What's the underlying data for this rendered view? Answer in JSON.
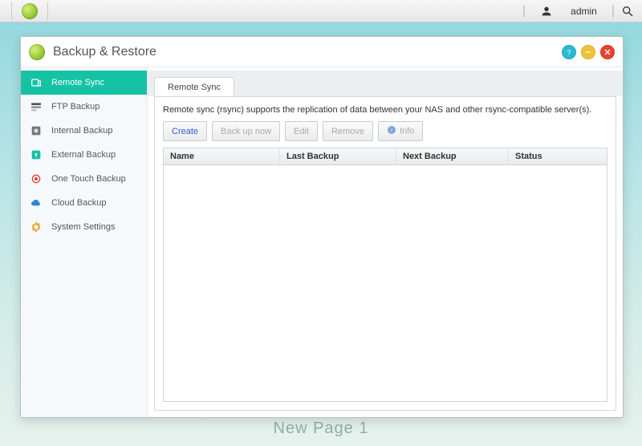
{
  "topbar": {
    "username": "admin"
  },
  "window": {
    "title": "Backup & Restore"
  },
  "sidebar": {
    "items": [
      {
        "label": "Remote Sync",
        "icon": "sync"
      },
      {
        "label": "FTP Backup",
        "icon": "ftp"
      },
      {
        "label": "Internal Backup",
        "icon": "internal"
      },
      {
        "label": "External Backup",
        "icon": "external"
      },
      {
        "label": "One Touch Backup",
        "icon": "touch"
      },
      {
        "label": "Cloud Backup",
        "icon": "cloud"
      },
      {
        "label": "System Settings",
        "icon": "gear"
      }
    ],
    "active_index": 0
  },
  "tabs": {
    "items": [
      {
        "label": "Remote Sync"
      }
    ],
    "active_index": 0
  },
  "main": {
    "description": "Remote sync (rsync) supports the replication of data between your NAS and other rsync-compatible server(s).",
    "buttons": {
      "create": "Create",
      "backup": "Back up now",
      "edit": "Edit",
      "remove": "Remove",
      "info": "Info"
    },
    "columns": {
      "name": "Name",
      "last": "Last Backup",
      "next": "Next Backup",
      "status": "Status"
    },
    "rows": []
  },
  "desktop": {
    "page_label": "New Page 1"
  }
}
